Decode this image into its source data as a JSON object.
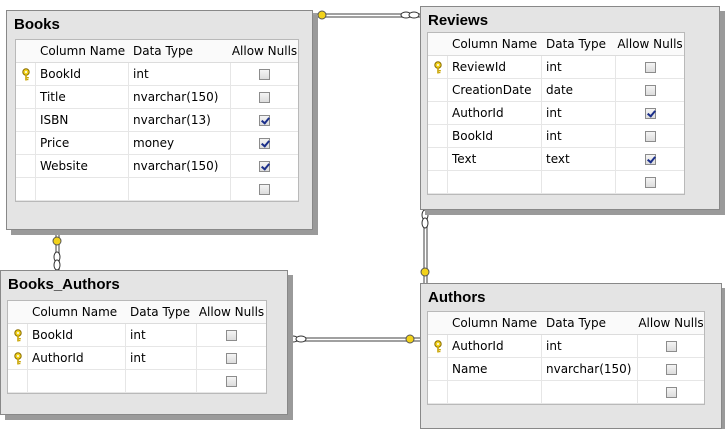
{
  "columns_header": {
    "name": "Column Name",
    "type": "Data Type",
    "nulls": "Allow Nulls"
  },
  "tables": {
    "books": {
      "title": "Books",
      "rows": [
        {
          "key": true,
          "name": "BookId",
          "type": "int",
          "nulls": false
        },
        {
          "key": false,
          "name": "Title",
          "type": "nvarchar(150)",
          "nulls": false
        },
        {
          "key": false,
          "name": "ISBN",
          "type": "nvarchar(13)",
          "nulls": true
        },
        {
          "key": false,
          "name": "Price",
          "type": "money",
          "nulls": true
        },
        {
          "key": false,
          "name": "Website",
          "type": "nvarchar(150)",
          "nulls": true
        },
        {
          "key": false,
          "name": "",
          "type": "",
          "nulls": false
        }
      ]
    },
    "reviews": {
      "title": "Reviews",
      "rows": [
        {
          "key": true,
          "name": "ReviewId",
          "type": "int",
          "nulls": false
        },
        {
          "key": false,
          "name": "CreationDate",
          "type": "date",
          "nulls": false
        },
        {
          "key": false,
          "name": "AuthorId",
          "type": "int",
          "nulls": true
        },
        {
          "key": false,
          "name": "BookId",
          "type": "int",
          "nulls": false
        },
        {
          "key": false,
          "name": "Text",
          "type": "text",
          "nulls": true
        },
        {
          "key": false,
          "name": "",
          "type": "",
          "nulls": false
        }
      ]
    },
    "books_authors": {
      "title": "Books_Authors",
      "rows": [
        {
          "key": true,
          "name": "BookId",
          "type": "int",
          "nulls": false
        },
        {
          "key": true,
          "name": "AuthorId",
          "type": "int",
          "nulls": false
        },
        {
          "key": false,
          "name": "",
          "type": "",
          "nulls": false
        }
      ]
    },
    "authors": {
      "title": "Authors",
      "rows": [
        {
          "key": true,
          "name": "AuthorId",
          "type": "int",
          "nulls": false
        },
        {
          "key": false,
          "name": "Name",
          "type": "nvarchar(150)",
          "nulls": false
        },
        {
          "key": false,
          "name": "",
          "type": "",
          "nulls": false
        }
      ]
    }
  },
  "colors": {
    "connector": "#808080",
    "key_icon": "#f2d21b",
    "check": "#1a2e8a"
  }
}
